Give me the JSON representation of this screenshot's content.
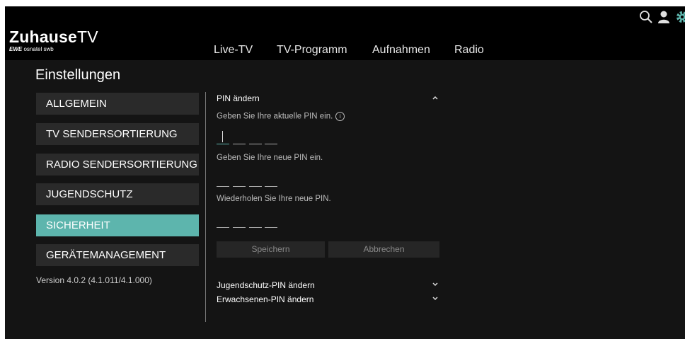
{
  "brand": {
    "name_bold": "Zuhause",
    "name_light": "TV",
    "partners_bold": "EWE",
    "partners": "osnatel swb"
  },
  "nav": {
    "items": [
      "Live-TV",
      "TV-Programm",
      "Aufnahmen",
      "Radio"
    ]
  },
  "header_icons": [
    "search-icon",
    "user-icon",
    "gear-icon"
  ],
  "colors": {
    "accent": "#5db5ad",
    "background": "#141414",
    "header": "#000000"
  },
  "settings": {
    "title": "Einstellungen",
    "menu": [
      {
        "label": "ALLGEMEIN"
      },
      {
        "label": "TV SENDERSORTIERUNG"
      },
      {
        "label": "RADIO SENDERSORTIERUNG"
      },
      {
        "label": "JUGENDSCHUTZ"
      },
      {
        "label": "SICHERHEIT",
        "active": true
      },
      {
        "label": "GERÄTEMANAGEMENT"
      }
    ],
    "version": "Version 4.0.2 (4.1.011/4.1.000)"
  },
  "security": {
    "pin_section": {
      "heading": "PIN ändern",
      "expanded": true,
      "current_pin_prompt": "Geben Sie Ihre aktuelle PIN ein.",
      "info_glyph": "i",
      "new_pin_prompt": "Geben Sie Ihre neue PIN ein.",
      "repeat_pin_prompt": "Wiederholen Sie Ihre neue PIN.",
      "save_label": "Speichern",
      "cancel_label": "Abbrechen"
    },
    "collapsed_sections": [
      {
        "heading": "Jugendschutz-PIN ändern"
      },
      {
        "heading": "Erwachsenen-PIN ändern"
      }
    ]
  }
}
